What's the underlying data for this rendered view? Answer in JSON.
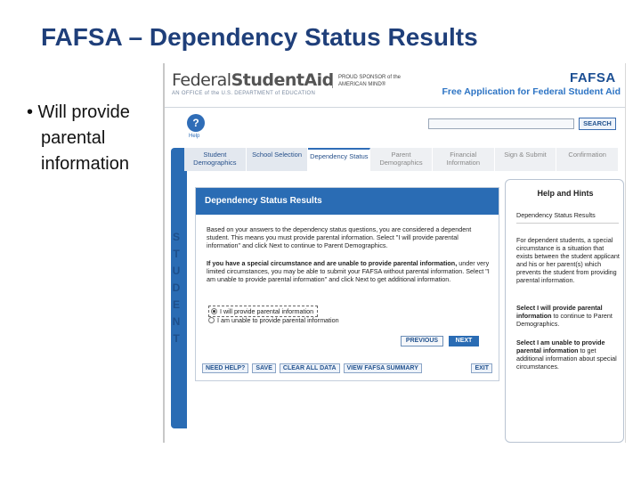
{
  "slide": {
    "title": "FAFSA – Dependency Status Results",
    "bullet_lines": [
      "• Will provide",
      "parental",
      "information"
    ]
  },
  "header": {
    "logo_federal": "Federal",
    "logo_student_aid": "StudentAid",
    "logo_sub": "AN OFFICE of the U.S. DEPARTMENT of EDUCATION",
    "sponsor": "PROUD SPONSOR of the AMERICAN MIND®",
    "fafsa_logo": "FAFSA",
    "fafsa_full": "Free Application for Federal Student Aid"
  },
  "toolbar": {
    "help_label": "Help",
    "search_label": "SEARCH"
  },
  "tabs": [
    {
      "label": "Student Demographics",
      "state": "done"
    },
    {
      "label": "School Selection",
      "state": "done"
    },
    {
      "label": "Dependency Status",
      "state": "active"
    },
    {
      "label": "Parent Demographics",
      "state": "pending"
    },
    {
      "label": "Financial Information",
      "state": "pending"
    },
    {
      "label": "Sign & Submit",
      "state": "pending"
    },
    {
      "label": "Confirmation",
      "state": "pending"
    }
  ],
  "side": {
    "letters": [
      "S",
      "T",
      "U",
      "D",
      "E",
      "N",
      "T"
    ]
  },
  "main": {
    "title": "Dependency Status Results",
    "para1": "Based on your answers to the dependency status questions, you are considered a dependent student. This means you must provide parental information. Select \"I will provide parental information\" and click Next to continue to Parent Demographics.",
    "para2_bold": "If you have a special circumstance and are unable to provide parental information,",
    "para2_rest": " under very limited circumstances, you may be able to submit your FAFSA without parental information. Select \"I am unable to provide parental information\" and click Next to get additional information.",
    "option1": "I will provide parental information",
    "option2": "I am unable to provide parental information",
    "previous": "PREVIOUS",
    "next": "NEXT"
  },
  "footer": {
    "need_help": "NEED HELP?",
    "save": "SAVE",
    "clear": "CLEAR ALL DATA",
    "view": "VIEW FAFSA SUMMARY",
    "exit": "EXIT"
  },
  "help_panel": {
    "title": "Help and Hints",
    "subtitle": "Dependency Status Results",
    "text1": "For dependent students, a special circumstance is a situation that exists between the student applicant and his or her parent(s) which prevents the student from providing parental information.",
    "text2_bold": "Select I will provide parental information",
    "text2_rest": " to continue to Parent Demographics.",
    "text3_bold": "Select I am unable to provide parental information",
    "text3_rest": " to get additional information about special circumstances."
  },
  "colors": {
    "title_blue": "#1f3f7a",
    "accent_blue": "#2a6cb4",
    "link_blue": "#23538f"
  }
}
